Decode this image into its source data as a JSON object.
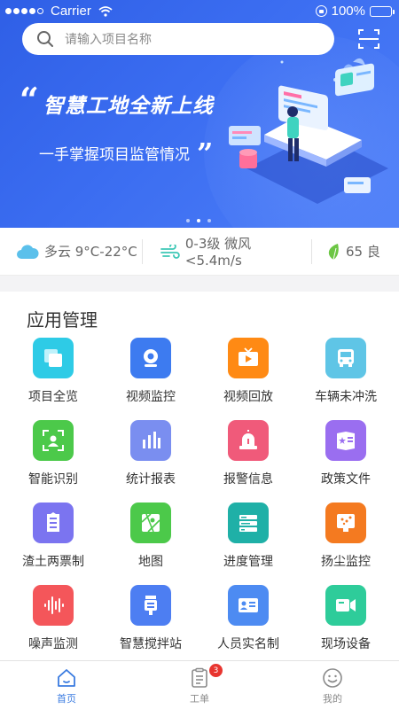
{
  "status_bar": {
    "carrier": "Carrier",
    "battery": "100%"
  },
  "search": {
    "placeholder": "请输入项目名称"
  },
  "banner": {
    "headline": "智慧工地全新上线",
    "subline": "一手掌握项目监管情况",
    "quote_open": "“",
    "quote_close": "”",
    "page_count": 3,
    "active_page": 1
  },
  "weather": {
    "condition": "多云 9°C-22°C",
    "wind": "0-3级 微风 <5.4m/s",
    "aqi": "65 良"
  },
  "apps": {
    "title": "应用管理",
    "items": [
      {
        "label": "项目全览",
        "icon": "layers-icon",
        "color": "#2ecbe6"
      },
      {
        "label": "视频监控",
        "icon": "webcam-icon",
        "color": "#3d7bf0"
      },
      {
        "label": "视频回放",
        "icon": "tv-play-icon",
        "color": "#ff8a14"
      },
      {
        "label": "车辆未冲洗",
        "icon": "truck-icon",
        "color": "#5fc5e6"
      },
      {
        "label": "智能识别",
        "icon": "face-scan-icon",
        "color": "#4cc94a"
      },
      {
        "label": "统计报表",
        "icon": "bar-chart-icon",
        "color": "#7a8ef0"
      },
      {
        "label": "报警信息",
        "icon": "alarm-light-icon",
        "color": "#f05a7a"
      },
      {
        "label": "政策文件",
        "icon": "document-star-icon",
        "color": "#9a6ef0"
      },
      {
        "label": "渣土两票制",
        "icon": "ticket-icon",
        "color": "#7b74f0"
      },
      {
        "label": "地图",
        "icon": "map-icon",
        "color": "#4cc94a"
      },
      {
        "label": "进度管理",
        "icon": "progress-list-icon",
        "color": "#1fb0a7"
      },
      {
        "label": "扬尘监控",
        "icon": "dust-monitor-icon",
        "color": "#f47a20"
      },
      {
        "label": "噪声监测",
        "icon": "sound-wave-icon",
        "color": "#f4565a"
      },
      {
        "label": "智慧搅拌站",
        "icon": "mixer-station-icon",
        "color": "#4d7ef2"
      },
      {
        "label": "人员实名制",
        "icon": "id-card-icon",
        "color": "#4d8bf2"
      },
      {
        "label": "现场设备",
        "icon": "camera-device-icon",
        "color": "#2ecc9a"
      }
    ]
  },
  "tabbar": {
    "items": [
      {
        "label": "首页",
        "icon": "home-icon",
        "active": true
      },
      {
        "label": "工单",
        "icon": "work-order-icon",
        "badge": "3"
      },
      {
        "label": "我的",
        "icon": "smiley-icon"
      }
    ]
  },
  "colors": {
    "accent": "#3a7be0",
    "banner_start": "#2f5fe6",
    "banner_end": "#4d7ef7",
    "badge": "#e8352f"
  }
}
